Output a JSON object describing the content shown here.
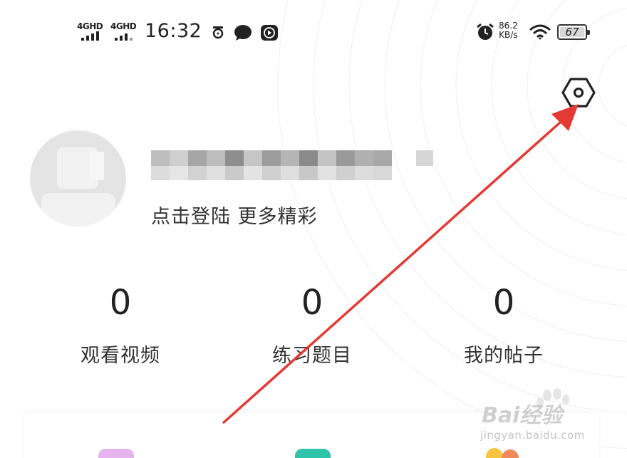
{
  "status_bar": {
    "signal1": "4GHD",
    "signal2": "4GHD",
    "time": "16:32",
    "net_speed_value": "86.2",
    "net_speed_unit": "KB/s",
    "battery_level": "67"
  },
  "profile": {
    "login_hint": "点击登陆 更多精彩"
  },
  "stats": [
    {
      "value": "0",
      "label": "观看视频"
    },
    {
      "value": "0",
      "label": "练习题目"
    },
    {
      "value": "0",
      "label": "我的帖子"
    }
  ],
  "colors": {
    "arrow": "#e53935",
    "card_icon_1": "#e6b3ee",
    "card_icon_2": "#2ec4a9",
    "card_icon_3": "#f5c542"
  },
  "watermark": {
    "brand": "Bai经验",
    "url": "jingyan.baidu.com"
  }
}
